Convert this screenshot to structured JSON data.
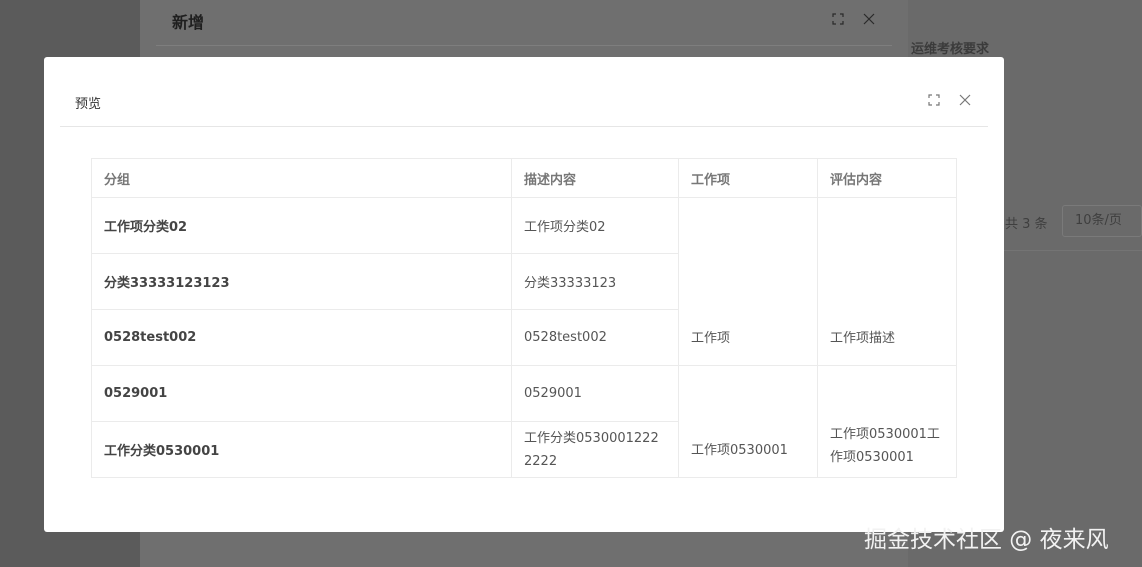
{
  "background": {
    "section_label": "运维考核要求",
    "pagination": {
      "total_text": "共 3 条",
      "page_size": "10条/页"
    }
  },
  "back_dialog": {
    "title": "新增"
  },
  "modal": {
    "title": "预览",
    "columns": [
      "分组",
      "描述内容",
      "工作项",
      "评估内容"
    ],
    "rows": [
      {
        "group": "工作项分类02",
        "description": "工作项分类02"
      },
      {
        "group": "分类33333123123",
        "description": "分类33333123"
      },
      {
        "group": "0528test002",
        "description": "0528test002"
      },
      {
        "group": "0529001",
        "description": "0529001"
      },
      {
        "group": "工作分类0530001",
        "description": "工作分类05300012222222"
      }
    ],
    "merged": {
      "work_item_a": "工作项",
      "evaluation_a": "工作项描述",
      "work_item_b": "工作项0530001",
      "evaluation_b": "工作项0530001工作项0530001"
    }
  },
  "watermark": "掘金技术社区 @ 夜来风",
  "icons": {
    "fullscreen": "fullscreen-icon",
    "close": "close-icon"
  }
}
